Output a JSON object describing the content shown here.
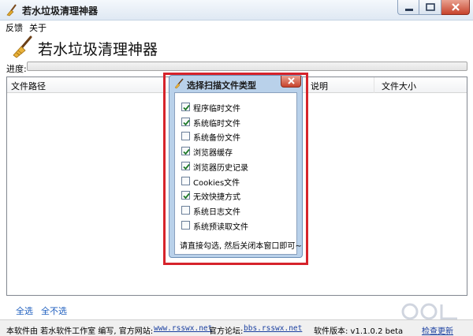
{
  "window": {
    "title": "若水垃圾清理神器"
  },
  "menu": {
    "items": [
      "反馈",
      "关于"
    ]
  },
  "header": {
    "app_name": "若水垃圾清理神器"
  },
  "progress": {
    "label": "进度:",
    "value": 0
  },
  "list": {
    "columns": [
      "文件路径",
      "说明",
      "文件大小"
    ],
    "rows": []
  },
  "footer": {
    "select_all": "全选",
    "select_none": "全不选"
  },
  "status": {
    "prefix": "本软件由 若水软件工作室 编写, 官方网站:",
    "website": "www.rsswx.net",
    "forum_label": "官方论坛:",
    "forum": "bbs.rsswx.net",
    "version": "软件版本: v1.1.0.2 beta",
    "update": "检查更新"
  },
  "dialog": {
    "title": "选择扫描文件类型",
    "options": [
      {
        "label": "程序临时文件",
        "checked": true
      },
      {
        "label": "系统临时文件",
        "checked": true
      },
      {
        "label": "系统备份文件",
        "checked": false
      },
      {
        "label": "浏览器缓存",
        "checked": true
      },
      {
        "label": "浏览器历史记录",
        "checked": true
      },
      {
        "label": "Cookies文件",
        "checked": false
      },
      {
        "label": "无效快捷方式",
        "checked": true
      },
      {
        "label": "系统日志文件",
        "checked": false
      },
      {
        "label": "系统预读取文件",
        "checked": false
      }
    ],
    "hint": "请直接勾选, 然后关闭本窗口即可~"
  },
  "colors": {
    "accent": "#1f5fbf",
    "highlight": "#d6232b",
    "dialog_frame": "#b9d1ea"
  }
}
